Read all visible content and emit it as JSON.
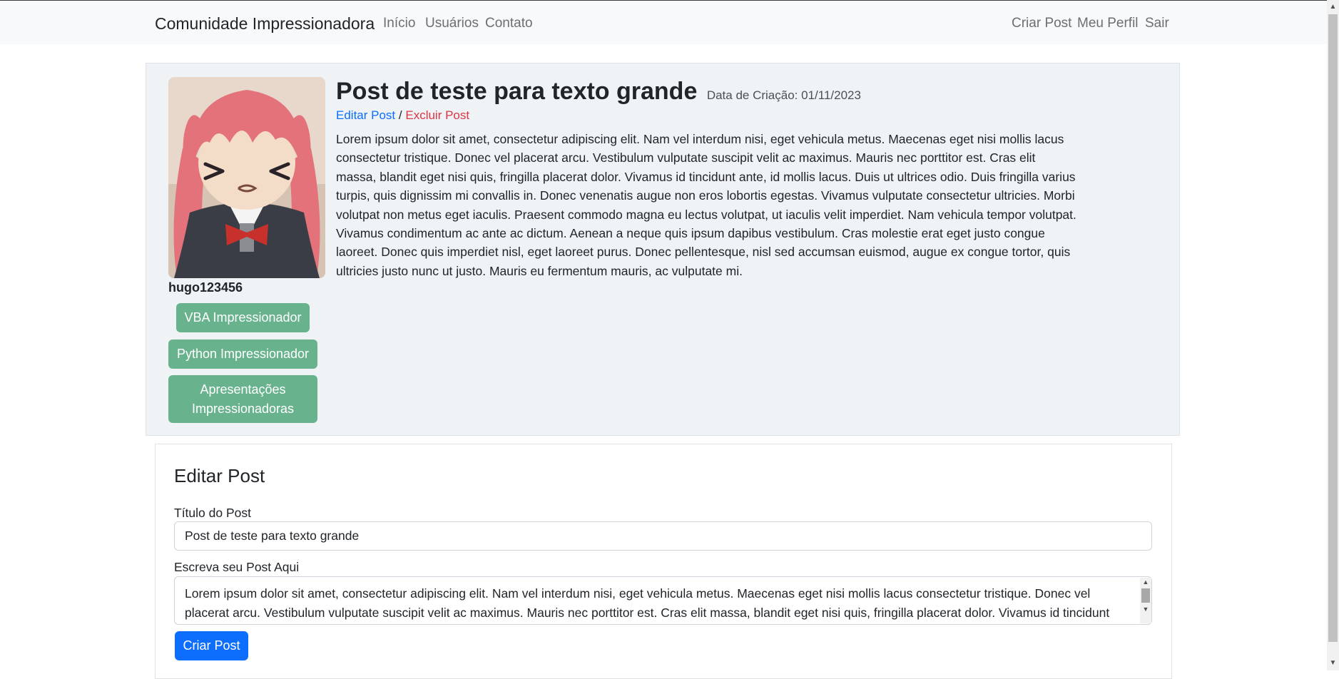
{
  "navbar": {
    "brand": "Comunidade Impressionadora",
    "links": [
      "Início",
      "Usuários",
      "Contato"
    ],
    "right_links": [
      "Criar Post",
      "Meu Perfil",
      "Sair"
    ]
  },
  "post": {
    "author": "hugo123456",
    "avatar_icon": "anime-girl-avatar-image",
    "tags": [
      "VBA Impressionador",
      "Python Impressionador",
      "Apresentações Impressionadoras"
    ],
    "title": "Post de teste para texto grande",
    "date": "Data de Criação: 01/11/2023",
    "edit_label": "Editar Post",
    "separator": "/",
    "delete_label": "Excluir Post",
    "body": "Lorem ipsum dolor sit amet, consectetur adipiscing elit. Nam vel interdum nisi, eget vehicula metus. Maecenas eget nisi mollis lacus consectetur tristique. Donec vel placerat arcu. Vestibulum vulputate suscipit velit ac maximus. Mauris nec porttitor est. Cras elit massa, blandit eget nisi quis, fringilla placerat dolor. Vivamus id tincidunt ante, id mollis lacus. Duis ut ultrices odio. Duis fringilla varius turpis, quis dignissim mi convallis in. Donec venenatis augue non eros lobortis egestas. Vivamus vulputate consectetur ultricies. Morbi volutpat non metus eget iaculis. Praesent commodo magna eu lectus volutpat, ut iaculis velit imperdiet. Nam vehicula tempor volutpat. Vivamus condimentum ac ante ac dictum. Aenean a neque quis ipsum dapibus vestibulum. Cras molestie erat eget justo congue laoreet. Donec quis imperdiet nisl, eget laoreet purus. Donec pellentesque, nisl sed accumsan euismod, augue ex congue tortor, quis ultricies justo nunc ut justo. Mauris eu fermentum mauris, ac vulputate mi."
  },
  "edit_form": {
    "heading": "Editar Post",
    "title_label": "Título do Post",
    "title_value": "Post de teste para texto grande",
    "body_label": "Escreva seu Post Aqui",
    "body_value": "Lorem ipsum dolor sit amet, consectetur adipiscing elit. Nam vel interdum nisi, eget vehicula metus. Maecenas eget nisi mollis lacus consectetur tristique. Donec vel placerat arcu. Vestibulum vulputate suscipit velit ac maximus. Mauris nec porttitor est. Cras elit massa, blandit eget nisi quis, fringilla placerat dolor. Vivamus id tincidunt ante, id mollis lacus. Duis ut ultrices odio. Duis fringilla varius turpis, quis dignissim mi convallis in.",
    "submit_label": "Criar Post"
  },
  "colors": {
    "tag_button": "#68b28d",
    "primary": "#0d6efd",
    "danger": "#dc3545",
    "card_bg": "#f0f3f6",
    "navbar_bg": "#f8f9fa"
  }
}
